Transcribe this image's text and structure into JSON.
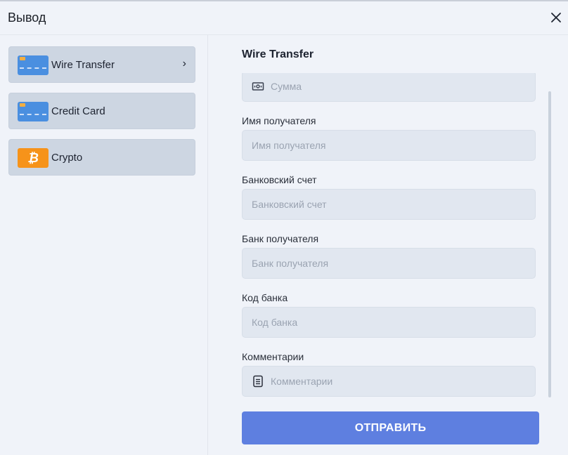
{
  "modal": {
    "title": "Вывод",
    "close_icon": "close-icon"
  },
  "methods": [
    {
      "label": "Wire Transfer",
      "icon": "bank-card-icon",
      "selected": true
    },
    {
      "label": "Credit Card",
      "icon": "bank-card-icon",
      "selected": false
    },
    {
      "label": "Crypto",
      "icon": "bitcoin-icon",
      "icon_glyph": "₿",
      "selected": false
    }
  ],
  "form": {
    "title": "Wire Transfer",
    "fields": [
      {
        "label": "",
        "placeholder": "Сумма",
        "value": "",
        "icon": "money-icon"
      },
      {
        "label": "Имя получателя",
        "placeholder": "Имя получателя",
        "value": ""
      },
      {
        "label": "Банковский счет",
        "placeholder": "Банковский счет",
        "value": ""
      },
      {
        "label": "Банк получателя",
        "placeholder": "Банк получателя",
        "value": ""
      },
      {
        "label": "Код банка",
        "placeholder": "Код банка",
        "value": ""
      },
      {
        "label": "Комментарии",
        "placeholder": "Комментарии",
        "value": "",
        "icon": "document-icon"
      }
    ],
    "submit_label": "ОТПРАВИТЬ"
  },
  "colors": {
    "accent": "#5e7fe0",
    "card_icon": "#4a8fe0",
    "bitcoin_icon": "#f6931a"
  }
}
